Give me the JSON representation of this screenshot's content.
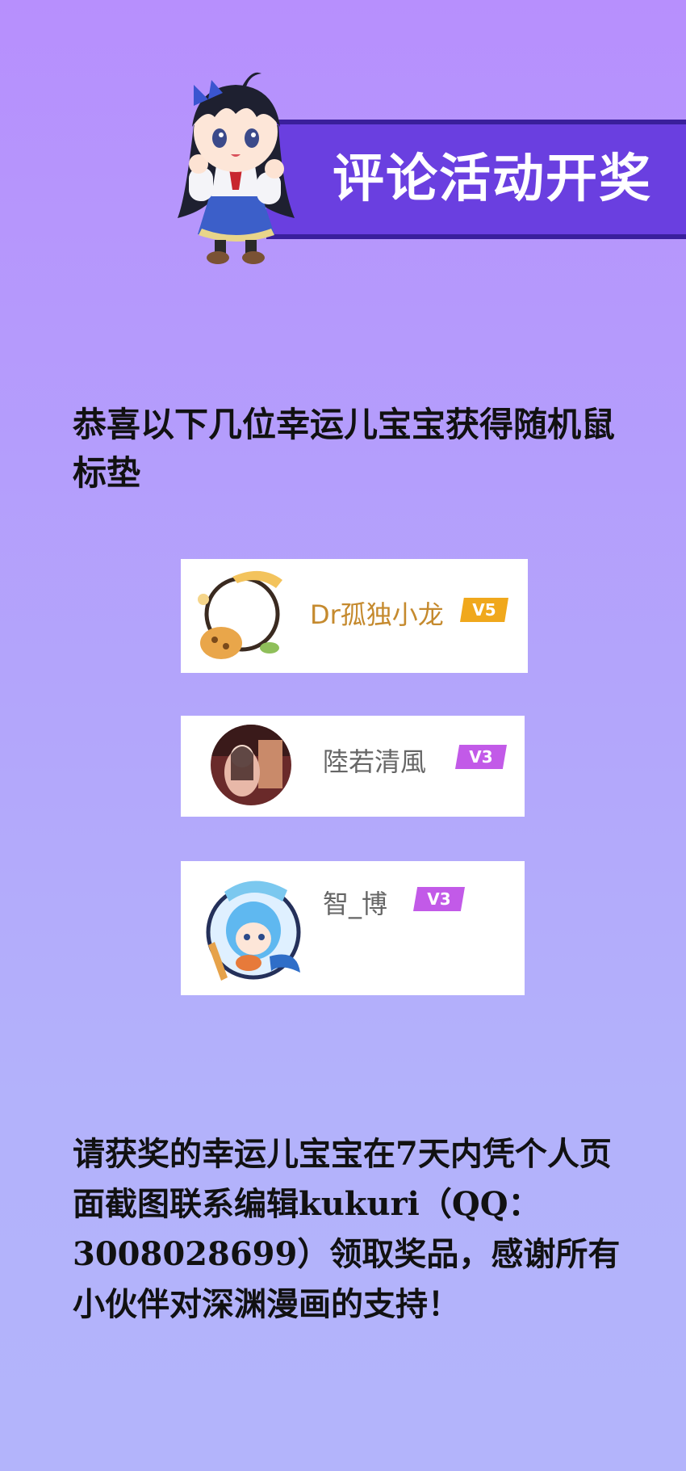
{
  "banner": {
    "title": "评论活动开奖"
  },
  "headline": "恭喜以下几位幸运儿宝宝获得随机鼠标垫",
  "winners": [
    {
      "name": "Dr孤独小龙",
      "level": "V5",
      "name_color": "#c58a2e",
      "badge_color": "#f0a81c"
    },
    {
      "name": "陸若清風",
      "level": "V3",
      "name_color": "#666666",
      "badge_color": "#c25ae8"
    },
    {
      "name": "智_博",
      "level": "V3",
      "name_color": "#666666",
      "badge_color": "#c25ae8"
    }
  ],
  "footer": "请获奖的幸运儿宝宝在7天内凭个人页面截图联系编辑kukuri（QQ：3008028699）领取奖品，感谢所有小伙伴对深渊漫画的支持！"
}
